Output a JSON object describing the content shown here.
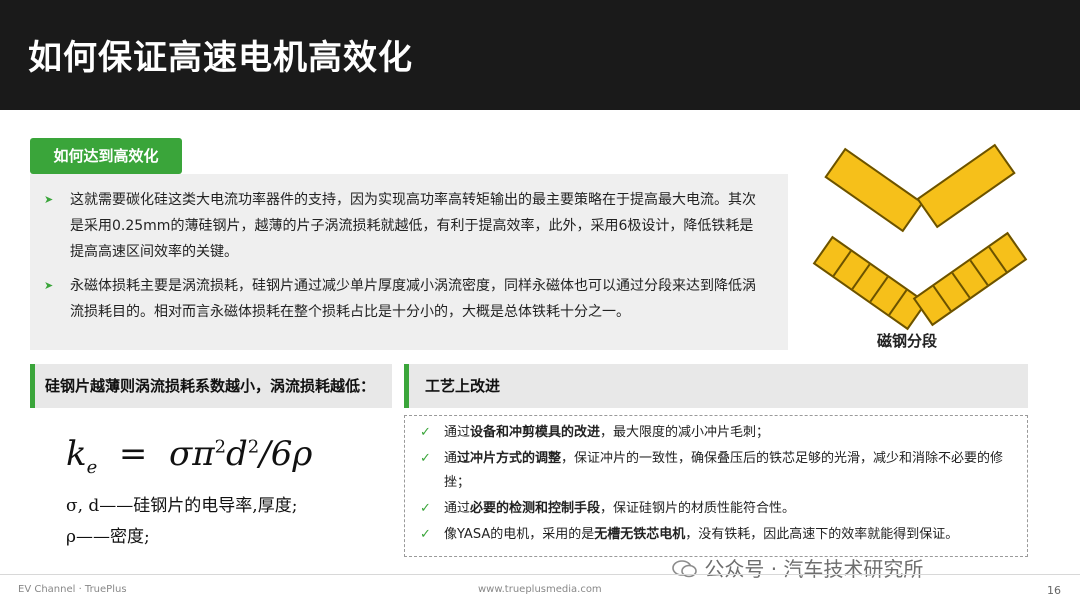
{
  "title": "如何保证高速电机高效化",
  "section_tag": "如何达到高效化",
  "bullets": [
    "这就需要碳化硅这类大电流功率器件的支持，因为实现高功率高转矩输出的最主要策略在于提高最大电流。其次是采用0.25mm的薄硅钢片，越薄的片子涡流损耗就越低，有利于提高效率，此外，采用6极设计，降低铁耗是提高高速区间效率的关键。",
    "永磁体损耗主要是涡流损耗，硅钢片通过减少单片厚度减小涡流密度，同样永磁体也可以通过分段来达到降低涡流损耗目的。相对而言永磁体损耗在整个损耗占比是十分小的，大概是总体铁耗十分之一。"
  ],
  "magnet_label": "磁钢分段",
  "left_subhead": "硅钢片越薄则涡流损耗系数越小，涡流损耗越低：",
  "formula": {
    "k": "k",
    "sub": "e",
    "eq": "=",
    "expr": "σπ",
    "exp1": "2",
    "d": "d",
    "exp2": "2",
    "tail": "/6ρ",
    "note1": "σ, d——硅钢片的电导率,厚度;",
    "note2": "ρ——密度;"
  },
  "right_subhead": "工艺上改进",
  "checks": [
    {
      "pre": "通过",
      "bold": "设备和冲剪模具的改进",
      "post": "，最大限度的减小冲片毛刺；"
    },
    {
      "pre": "通",
      "bold": "过冲片方式的调整",
      "post": "，保证冲片的一致性，确保叠压后的铁芯足够的光滑，减少和消除不必要的修挫；"
    },
    {
      "pre": "通过",
      "bold": "必要的检测和控制手段",
      "post": "，保证硅钢片的材质性能符合性。"
    },
    {
      "pre": "像YASA的电机，采用的是",
      "bold": "无槽无铁芯电机",
      "post": "，没有铁耗，因此高速下的效率就能得到保证。"
    }
  ],
  "footer": {
    "left": "EV Channel · TruePlus",
    "mid": "www.trueplusmedia.com",
    "page": "16"
  },
  "watermark": "公众号 · 汽车技术研究所",
  "colors": {
    "accent": "#3aa53a",
    "title_bg": "#1a1a1a",
    "magnet": "#f6c01a"
  }
}
